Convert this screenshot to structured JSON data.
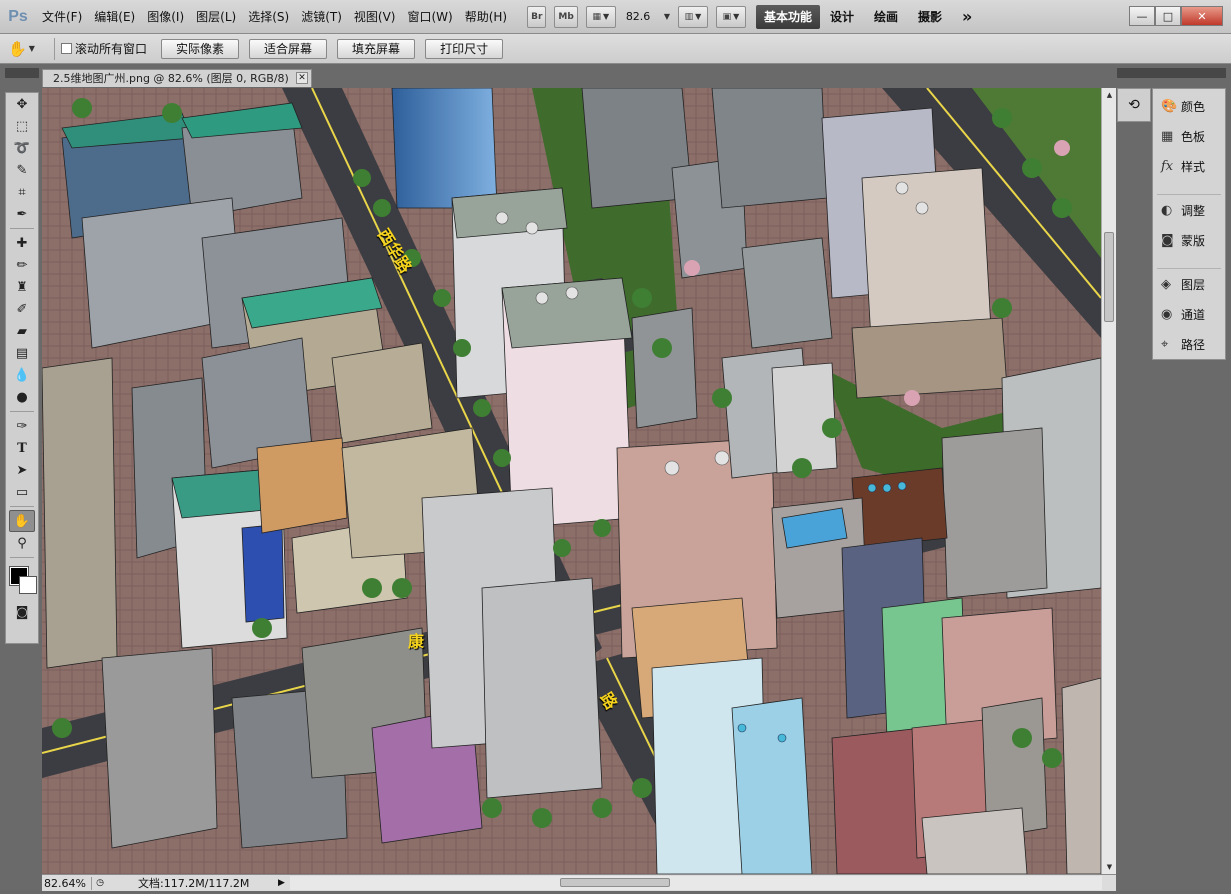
{
  "app": {
    "logo": "Ps"
  },
  "menu": [
    "文件(F)",
    "编辑(E)",
    "图像(I)",
    "图层(L)",
    "选择(S)",
    "滤镜(T)",
    "视图(V)",
    "窗口(W)",
    "帮助(H)"
  ],
  "menubar_controls": {
    "bridge_label": "Br",
    "minibridge_label": "Mb",
    "zoom_value": "82.6",
    "workspaces": [
      "基本功能",
      "设计",
      "绘画",
      "摄影"
    ],
    "more_label": "»"
  },
  "window_buttons": {
    "minimize": "—",
    "restore": "□",
    "close": "✕"
  },
  "options_bar": {
    "scroll_all_label": "滚动所有窗口",
    "buttons": [
      "实际像素",
      "适合屏幕",
      "填充屏幕",
      "打印尺寸"
    ]
  },
  "document": {
    "tab_title": "2.5维地图广州.png @ 82.6% (图层 0, RGB/8)",
    "close_label": "✕"
  },
  "canvas_labels": {
    "road_1": "西华路",
    "road_2_char": "康",
    "road_3_char": "路"
  },
  "status": {
    "zoom": "82.64%",
    "doc_info": "文档:117.2M/117.2M",
    "arrow": "▶"
  },
  "right_panel": {
    "items": [
      {
        "label": "颜色",
        "icon": "palette-icon"
      },
      {
        "label": "色板",
        "icon": "swatches-icon"
      },
      {
        "label": "样式",
        "icon": "styles-icon"
      },
      {
        "label": "调整",
        "icon": "adjustments-icon"
      },
      {
        "label": "蒙版",
        "icon": "masks-icon"
      },
      {
        "label": "图层",
        "icon": "layers-icon"
      },
      {
        "label": "通道",
        "icon": "channels-icon"
      },
      {
        "label": "路径",
        "icon": "paths-icon"
      }
    ]
  },
  "colors": {
    "accent_dark": "#3a3a3a",
    "road_line": "#e9d54a",
    "road_label": "#f5d31c"
  }
}
